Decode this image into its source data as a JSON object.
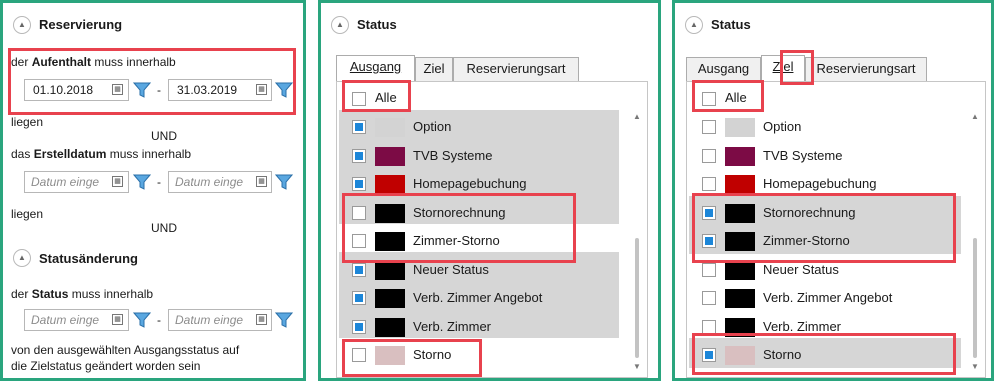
{
  "panel1": {
    "reservierung": {
      "title": "Reservierung",
      "line1_pre": "der ",
      "line1_bold": "Aufenthalt",
      "line1_post": " muss innerhalb",
      "date_from": "01.10.2018",
      "date_to": "31.03.2019",
      "dash": "-",
      "liegen": "liegen",
      "und": "UND",
      "line2_pre": "das ",
      "line2_bold": "Erstelldatum",
      "line2_post": " muss innerhalb",
      "placeholder": "Datum einge"
    },
    "statusaenderung": {
      "title": "Statusänderung",
      "line_pre": "der ",
      "line_bold": "Status",
      "line_post": " muss innerhalb",
      "placeholder": "Datum einge",
      "desc1": "von den ausgewählten Ausgangsstatus auf",
      "desc2": "die Zielstatus geändert worden sein"
    }
  },
  "status_panel": {
    "title": "Status",
    "tabs": [
      "Ausgang",
      "Ziel",
      "Reservierungsart"
    ],
    "alle": "Alle",
    "items": [
      {
        "label": "Option",
        "color": "#d3d3d3"
      },
      {
        "label": "TVB Systeme",
        "color": "#7c0b45"
      },
      {
        "label": "Homepagebuchung",
        "color": "#c00000"
      },
      {
        "label": "Stornorechnung",
        "color": "#000000"
      },
      {
        "label": "Zimmer-Storno",
        "color": "#000000"
      },
      {
        "label": "Neuer Status",
        "color": "#000000"
      },
      {
        "label": "Verb. Zimmer Angebot",
        "color": "#000000"
      },
      {
        "label": "Verb. Zimmer",
        "color": "#000000"
      },
      {
        "label": "Storno",
        "color": "#d9bfc0"
      }
    ],
    "ausgang_checked": [
      true,
      true,
      true,
      false,
      false,
      true,
      true,
      true,
      false
    ],
    "ziel_checked": [
      false,
      false,
      false,
      true,
      true,
      false,
      false,
      false,
      true
    ],
    "accent": "#1c86d8",
    "highlight": "#e8424e",
    "border": "#2aa57e"
  }
}
